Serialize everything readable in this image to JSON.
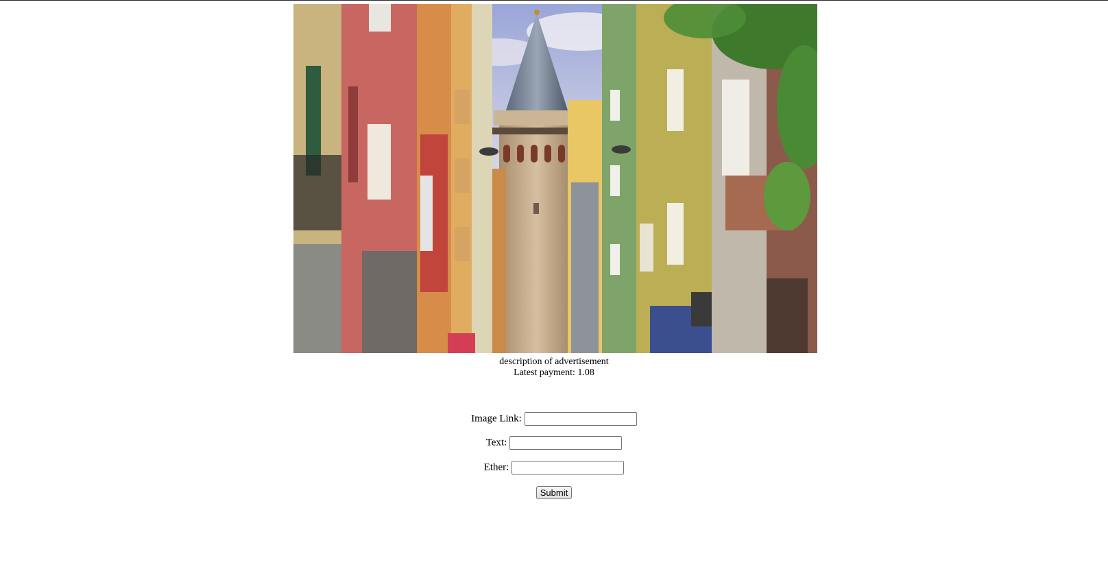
{
  "ad": {
    "image_alt": "Colorful street with stone tower",
    "description": "description of advertisement",
    "latest_payment": "Latest payment: 1.08"
  },
  "form": {
    "image_link_label": "Image Link:",
    "image_link_value": "",
    "text_label": "Text:",
    "text_value": "",
    "ether_label": "Ether:",
    "ether_value": "",
    "submit_label": "Submit"
  }
}
